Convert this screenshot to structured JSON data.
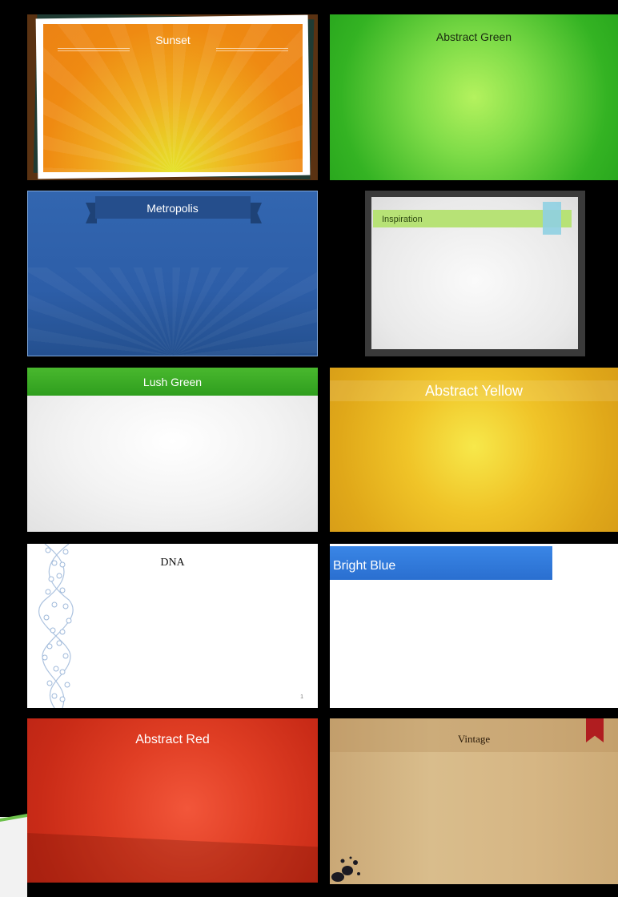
{
  "themes": [
    {
      "id": "sunset",
      "title": "Sunset"
    },
    {
      "id": "abstract-green",
      "title": "Abstract Green"
    },
    {
      "id": "metropolis",
      "title": "Metropolis"
    },
    {
      "id": "inspiration",
      "title": "Inspiration"
    },
    {
      "id": "lush-green",
      "title": "Lush Green"
    },
    {
      "id": "abstract-yellow",
      "title": "Abstract Yellow"
    },
    {
      "id": "dna",
      "title": "DNA",
      "page_number": "1"
    },
    {
      "id": "bright-blue",
      "title": "Bright Blue"
    },
    {
      "id": "abstract-red",
      "title": "Abstract Red"
    },
    {
      "id": "vintage",
      "title": "Vintage"
    }
  ],
  "colors": {
    "background": "#000000",
    "sunset": "#ec8214",
    "abstract_green": "#34b323",
    "metropolis": "#2d5ea8",
    "inspiration_band": "#b7e276",
    "lush_green": "#3aaa24",
    "abstract_yellow": "#f0c428",
    "bright_blue": "#2a6fd0",
    "abstract_red": "#e03e24",
    "vintage": "#d6b684",
    "vintage_bookmark": "#b01d20"
  }
}
